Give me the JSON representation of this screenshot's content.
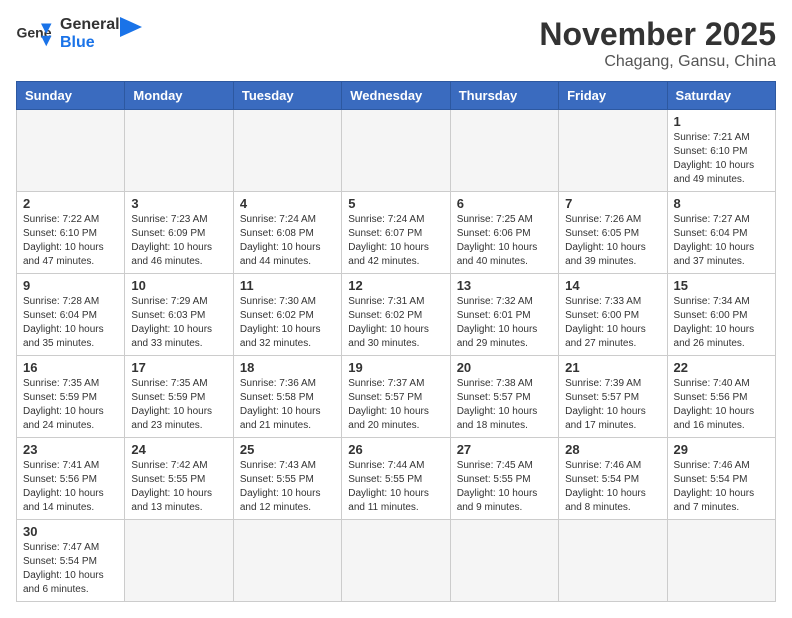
{
  "header": {
    "logo_general": "General",
    "logo_blue": "Blue",
    "month": "November 2025",
    "location": "Chagang, Gansu, China"
  },
  "weekdays": [
    "Sunday",
    "Monday",
    "Tuesday",
    "Wednesday",
    "Thursday",
    "Friday",
    "Saturday"
  ],
  "weeks": [
    [
      {
        "day": "",
        "info": ""
      },
      {
        "day": "",
        "info": ""
      },
      {
        "day": "",
        "info": ""
      },
      {
        "day": "",
        "info": ""
      },
      {
        "day": "",
        "info": ""
      },
      {
        "day": "",
        "info": ""
      },
      {
        "day": "1",
        "info": "Sunrise: 7:21 AM\nSunset: 6:10 PM\nDaylight: 10 hours\nand 49 minutes."
      }
    ],
    [
      {
        "day": "2",
        "info": "Sunrise: 7:22 AM\nSunset: 6:10 PM\nDaylight: 10 hours\nand 47 minutes."
      },
      {
        "day": "3",
        "info": "Sunrise: 7:23 AM\nSunset: 6:09 PM\nDaylight: 10 hours\nand 46 minutes."
      },
      {
        "day": "4",
        "info": "Sunrise: 7:24 AM\nSunset: 6:08 PM\nDaylight: 10 hours\nand 44 minutes."
      },
      {
        "day": "5",
        "info": "Sunrise: 7:24 AM\nSunset: 6:07 PM\nDaylight: 10 hours\nand 42 minutes."
      },
      {
        "day": "6",
        "info": "Sunrise: 7:25 AM\nSunset: 6:06 PM\nDaylight: 10 hours\nand 40 minutes."
      },
      {
        "day": "7",
        "info": "Sunrise: 7:26 AM\nSunset: 6:05 PM\nDaylight: 10 hours\nand 39 minutes."
      },
      {
        "day": "8",
        "info": "Sunrise: 7:27 AM\nSunset: 6:04 PM\nDaylight: 10 hours\nand 37 minutes."
      }
    ],
    [
      {
        "day": "9",
        "info": "Sunrise: 7:28 AM\nSunset: 6:04 PM\nDaylight: 10 hours\nand 35 minutes."
      },
      {
        "day": "10",
        "info": "Sunrise: 7:29 AM\nSunset: 6:03 PM\nDaylight: 10 hours\nand 33 minutes."
      },
      {
        "day": "11",
        "info": "Sunrise: 7:30 AM\nSunset: 6:02 PM\nDaylight: 10 hours\nand 32 minutes."
      },
      {
        "day": "12",
        "info": "Sunrise: 7:31 AM\nSunset: 6:02 PM\nDaylight: 10 hours\nand 30 minutes."
      },
      {
        "day": "13",
        "info": "Sunrise: 7:32 AM\nSunset: 6:01 PM\nDaylight: 10 hours\nand 29 minutes."
      },
      {
        "day": "14",
        "info": "Sunrise: 7:33 AM\nSunset: 6:00 PM\nDaylight: 10 hours\nand 27 minutes."
      },
      {
        "day": "15",
        "info": "Sunrise: 7:34 AM\nSunset: 6:00 PM\nDaylight: 10 hours\nand 26 minutes."
      }
    ],
    [
      {
        "day": "16",
        "info": "Sunrise: 7:35 AM\nSunset: 5:59 PM\nDaylight: 10 hours\nand 24 minutes."
      },
      {
        "day": "17",
        "info": "Sunrise: 7:35 AM\nSunset: 5:59 PM\nDaylight: 10 hours\nand 23 minutes."
      },
      {
        "day": "18",
        "info": "Sunrise: 7:36 AM\nSunset: 5:58 PM\nDaylight: 10 hours\nand 21 minutes."
      },
      {
        "day": "19",
        "info": "Sunrise: 7:37 AM\nSunset: 5:57 PM\nDaylight: 10 hours\nand 20 minutes."
      },
      {
        "day": "20",
        "info": "Sunrise: 7:38 AM\nSunset: 5:57 PM\nDaylight: 10 hours\nand 18 minutes."
      },
      {
        "day": "21",
        "info": "Sunrise: 7:39 AM\nSunset: 5:57 PM\nDaylight: 10 hours\nand 17 minutes."
      },
      {
        "day": "22",
        "info": "Sunrise: 7:40 AM\nSunset: 5:56 PM\nDaylight: 10 hours\nand 16 minutes."
      }
    ],
    [
      {
        "day": "23",
        "info": "Sunrise: 7:41 AM\nSunset: 5:56 PM\nDaylight: 10 hours\nand 14 minutes."
      },
      {
        "day": "24",
        "info": "Sunrise: 7:42 AM\nSunset: 5:55 PM\nDaylight: 10 hours\nand 13 minutes."
      },
      {
        "day": "25",
        "info": "Sunrise: 7:43 AM\nSunset: 5:55 PM\nDaylight: 10 hours\nand 12 minutes."
      },
      {
        "day": "26",
        "info": "Sunrise: 7:44 AM\nSunset: 5:55 PM\nDaylight: 10 hours\nand 11 minutes."
      },
      {
        "day": "27",
        "info": "Sunrise: 7:45 AM\nSunset: 5:55 PM\nDaylight: 10 hours\nand 9 minutes."
      },
      {
        "day": "28",
        "info": "Sunrise: 7:46 AM\nSunset: 5:54 PM\nDaylight: 10 hours\nand 8 minutes."
      },
      {
        "day": "29",
        "info": "Sunrise: 7:46 AM\nSunset: 5:54 PM\nDaylight: 10 hours\nand 7 minutes."
      }
    ],
    [
      {
        "day": "30",
        "info": "Sunrise: 7:47 AM\nSunset: 5:54 PM\nDaylight: 10 hours\nand 6 minutes."
      },
      {
        "day": "",
        "info": ""
      },
      {
        "day": "",
        "info": ""
      },
      {
        "day": "",
        "info": ""
      },
      {
        "day": "",
        "info": ""
      },
      {
        "day": "",
        "info": ""
      },
      {
        "day": "",
        "info": ""
      }
    ]
  ]
}
